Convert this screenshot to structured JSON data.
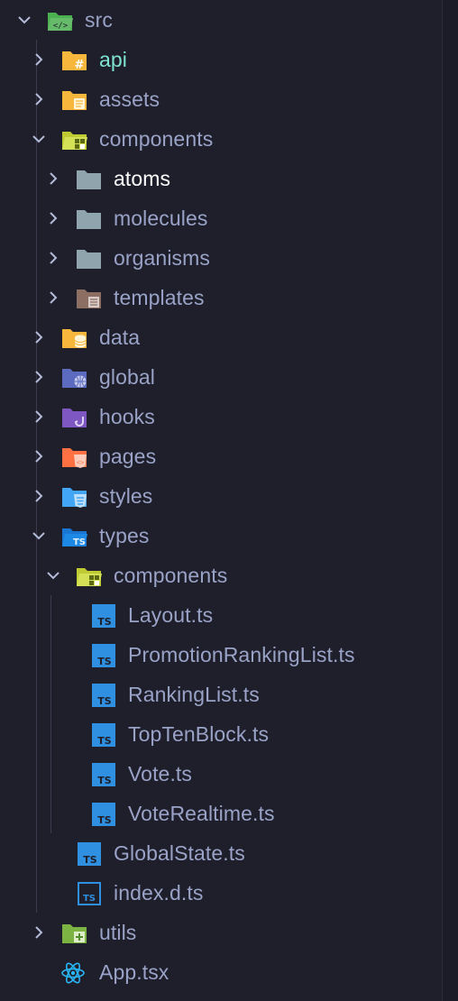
{
  "explorer": {
    "items": [
      {
        "label": "src",
        "icon": "folder-src-open-icon",
        "expanded": true
      },
      {
        "label": "api",
        "icon": "folder-api-icon",
        "expanded": false,
        "color": "#7fe3d1"
      },
      {
        "label": "assets",
        "icon": "folder-assets-icon",
        "expanded": false
      },
      {
        "label": "components",
        "icon": "folder-components-open-icon",
        "expanded": true
      },
      {
        "label": "atoms",
        "icon": "folder-plain-icon",
        "expanded": false,
        "color": "#ffffff"
      },
      {
        "label": "molecules",
        "icon": "folder-plain-icon",
        "expanded": false
      },
      {
        "label": "organisms",
        "icon": "folder-plain-icon",
        "expanded": false
      },
      {
        "label": "templates",
        "icon": "folder-templates-icon",
        "expanded": false
      },
      {
        "label": "data",
        "icon": "folder-data-icon",
        "expanded": false
      },
      {
        "label": "global",
        "icon": "folder-global-icon",
        "expanded": false
      },
      {
        "label": "hooks",
        "icon": "folder-hooks-icon",
        "expanded": false
      },
      {
        "label": "pages",
        "icon": "folder-pages-icon",
        "expanded": false
      },
      {
        "label": "styles",
        "icon": "folder-styles-icon",
        "expanded": false
      },
      {
        "label": "types",
        "icon": "folder-types-open-icon",
        "expanded": true
      },
      {
        "label": "components",
        "icon": "folder-components-open-icon",
        "expanded": true
      },
      {
        "label": "Layout.ts",
        "icon": "typescript-file-icon"
      },
      {
        "label": "PromotionRankingList.ts",
        "icon": "typescript-file-icon"
      },
      {
        "label": "RankingList.ts",
        "icon": "typescript-file-icon"
      },
      {
        "label": "TopTenBlock.ts",
        "icon": "typescript-file-icon"
      },
      {
        "label": "Vote.ts",
        "icon": "typescript-file-icon"
      },
      {
        "label": "VoteRealtime.ts",
        "icon": "typescript-file-icon"
      },
      {
        "label": "GlobalState.ts",
        "icon": "typescript-file-icon"
      },
      {
        "label": "index.d.ts",
        "icon": "typescript-definition-icon"
      },
      {
        "label": "utils",
        "icon": "folder-utils-icon",
        "expanded": false
      },
      {
        "label": "App.tsx",
        "icon": "react-icon"
      }
    ]
  },
  "colors": {
    "background": "#1e1f2b",
    "text": "#9aa3c7",
    "chevron": "#b4bbd8",
    "guide": "#3a3c4e",
    "ts_blue": "#2f8fe0"
  }
}
